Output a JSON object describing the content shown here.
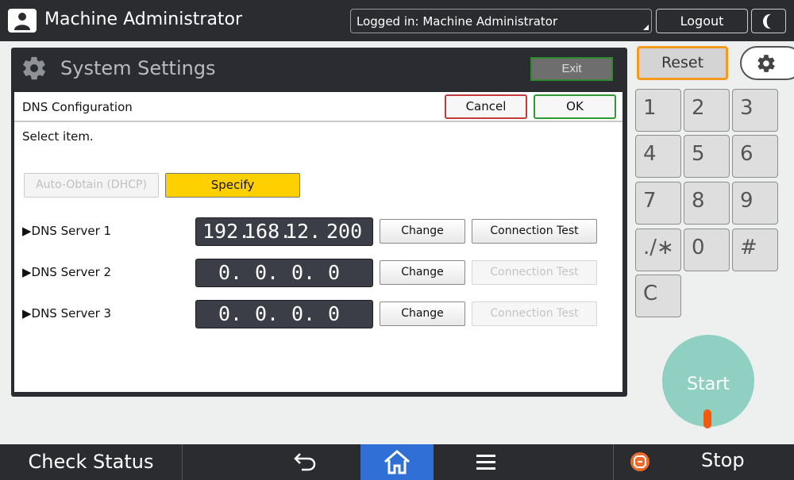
{
  "topbar": {
    "user_title": "Machine Administrator",
    "login_status": "Logged in: Machine Administrator",
    "logout_label": "Logout",
    "icons": {
      "user": "user-icon",
      "display_mode": "moon-icon"
    }
  },
  "system_settings": {
    "title": "System Settings",
    "exit_label": "Exit",
    "icon": "gear-icon"
  },
  "dns": {
    "title": "DNS Configuration",
    "cancel_label": "Cancel",
    "ok_label": "OK",
    "prompt": "Select item.",
    "mode_auto_label": "Auto-Obtain (DHCP)",
    "mode_specify_label": "Specify",
    "selected_mode": "Specify",
    "servers": [
      {
        "label": "▶DNS Server 1",
        "octets": [
          "192.",
          "168.",
          "12.",
          "200"
        ],
        "change_label": "Change",
        "test_label": "Connection Test",
        "test_enabled": true
      },
      {
        "label": "▶DNS Server 2",
        "octets": [
          "0.",
          "0.",
          "0.",
          "0"
        ],
        "change_label": "Change",
        "test_label": "Connection Test",
        "test_enabled": false
      },
      {
        "label": "▶DNS Server 3",
        "octets": [
          "0.",
          "0.",
          "0.",
          "0"
        ],
        "change_label": "Change",
        "test_label": "Connection Test",
        "test_enabled": false
      }
    ]
  },
  "keypad": {
    "reset_label": "Reset",
    "keys": [
      "1",
      "2",
      "3",
      "4",
      "5",
      "6",
      "7",
      "8",
      "9",
      "./∗",
      "0",
      "#",
      "C"
    ],
    "start_label": "Start"
  },
  "bottombar": {
    "check_status_label": "Check Status",
    "stop_label": "Stop",
    "icons": {
      "back": "back-arrow-icon",
      "home": "home-icon",
      "menu": "menu-icon",
      "stop": "stop-icon"
    }
  },
  "colors": {
    "specify_selected": "#ffd000",
    "reset_border": "#f29b1d",
    "home_active": "#2f6fd6",
    "start_button": "#8fd0c3",
    "cancel_border": "#c23b3b",
    "ok_border": "#2f9a2f"
  }
}
